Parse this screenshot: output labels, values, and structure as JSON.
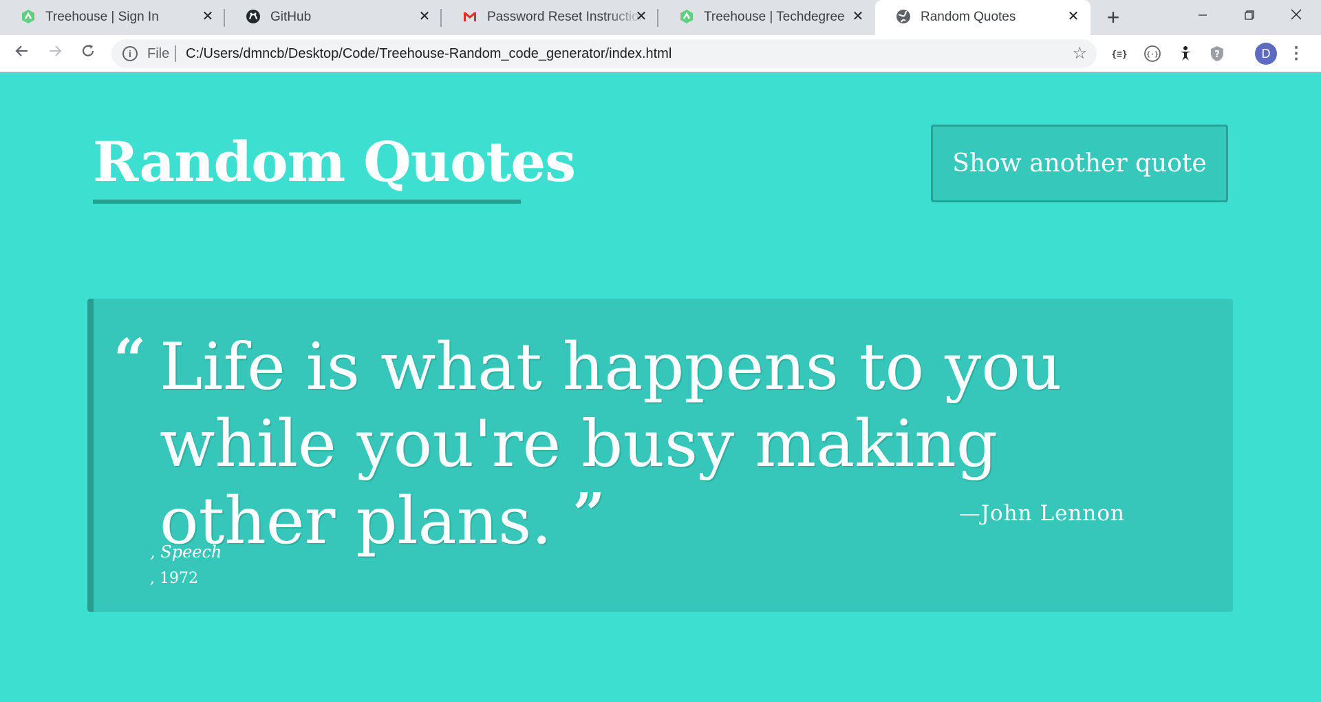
{
  "browser": {
    "tabs": [
      {
        "title": "Treehouse | Sign In",
        "icon": "treehouse-icon"
      },
      {
        "title": "GitHub",
        "icon": "github-icon"
      },
      {
        "title": "Password Reset Instructions",
        "icon": "gmail-icon"
      },
      {
        "title": "Treehouse | Techdegree",
        "icon": "treehouse-icon"
      },
      {
        "title": "Random Quotes",
        "icon": "globe-icon",
        "active": true
      }
    ],
    "close_glyph": "✕",
    "new_tab_glyph": "+",
    "scheme_label": "File",
    "url": "C:/Users/dmncb/Desktop/Code/Treehouse-Random_code_generator/index.html",
    "avatar_letter": "D"
  },
  "page": {
    "title": "Random Quotes",
    "button_label": "Show another quote",
    "quote": {
      "text": "Life is what happens to you while you're busy making other plans.",
      "source": "—John Lennon",
      "citation": ", Speech",
      "year": ", 1972"
    }
  },
  "colors": {
    "background": "#3ddfd1",
    "quote_box": "#36c7ba",
    "accent_border": "#2a9d8f",
    "text": "#ffffff"
  }
}
